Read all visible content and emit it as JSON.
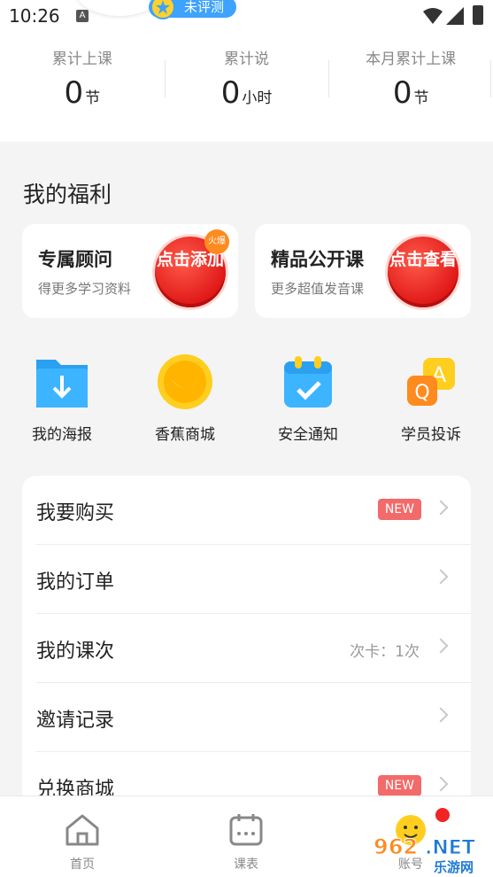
{
  "status_bar": {
    "time": "10:26"
  },
  "profile": {
    "evaluation_badge": "未评测"
  },
  "stats": [
    {
      "label": "累计上课",
      "value": "0",
      "unit": "节"
    },
    {
      "label": "累计说",
      "value": "0",
      "unit": "小时"
    },
    {
      "label": "本月累计上课",
      "value": "0",
      "unit": "节"
    }
  ],
  "welfare": {
    "title": "我的福利",
    "cards": [
      {
        "title": "专属顾问",
        "subtitle": "得更多学习资料",
        "button": "点击添加",
        "hot_tag": "火爆"
      },
      {
        "title": "精品公开课",
        "subtitle": "更多超值发音课",
        "button": "点击查看"
      }
    ]
  },
  "quick_actions": [
    {
      "label": "我的海报",
      "icon": "folder-download-icon"
    },
    {
      "label": "香蕉商城",
      "icon": "banana-coin-icon"
    },
    {
      "label": "安全通知",
      "icon": "calendar-check-icon"
    },
    {
      "label": "学员投诉",
      "icon": "qa-icon"
    }
  ],
  "menu": [
    {
      "label": "我要购买",
      "badge": "NEW"
    },
    {
      "label": "我的订单"
    },
    {
      "label": "我的课次",
      "right_text": "次卡：1次"
    },
    {
      "label": "邀请记录"
    },
    {
      "label": "兑换商城",
      "badge": "NEW"
    }
  ],
  "tabs": [
    {
      "label": "首页",
      "icon": "home-icon"
    },
    {
      "label": "课表",
      "icon": "calendar-icon"
    },
    {
      "label": "账号",
      "icon": "account-face-icon"
    }
  ],
  "watermark": "962.NET 乐游网",
  "colors": {
    "accent": "#3ea2ff",
    "badge_red": "#f36a6a",
    "button_red": "#e01818",
    "background": "#f4f4f4"
  }
}
